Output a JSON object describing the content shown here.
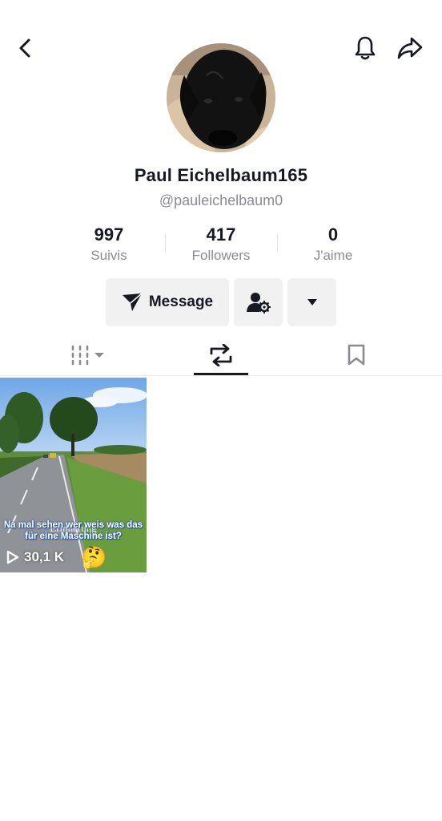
{
  "header": {
    "back_icon": "chevron-left-icon",
    "bell_icon": "bell-icon",
    "share_icon": "share-arrow-icon"
  },
  "profile": {
    "name": "Paul Eichelbaum165",
    "handle": "@pauleichelbaum0"
  },
  "stats": [
    {
      "value": "997",
      "label": "Suivis"
    },
    {
      "value": "417",
      "label": "Followers"
    },
    {
      "value": "0",
      "label": "J'aime"
    }
  ],
  "actions": {
    "message_label": "Message",
    "add_friend_icon": "person-gear-icon",
    "more_icon": "caret-down-icon"
  },
  "tabs": [
    {
      "id": "videos",
      "icon": "grid-bars-icon",
      "active": false
    },
    {
      "id": "reposts",
      "icon": "repost-icon",
      "active": true
    },
    {
      "id": "saved",
      "icon": "bookmark-icon",
      "active": false
    }
  ],
  "videos": [
    {
      "caption": "Na mal sehen wer weis was das für eine Maschine ist?",
      "overlay_word": "Erinnerung",
      "views": "30,1 K",
      "emoji": "🤔"
    }
  ],
  "colors": {
    "text": "#161823",
    "muted": "#8a8b91",
    "button_bg": "#f1f1f2"
  }
}
